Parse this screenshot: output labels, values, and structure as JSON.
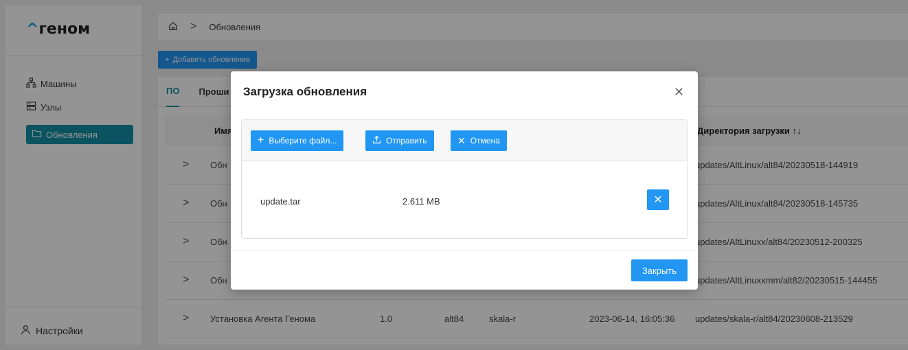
{
  "logo": {
    "caret": "^",
    "text": "геном"
  },
  "sidebar": {
    "items": [
      {
        "label": "Машины",
        "icon": "sitemap-icon"
      },
      {
        "label": "Узлы",
        "icon": "server-icon"
      },
      {
        "label": "Обновления",
        "icon": "folder-icon",
        "active": true
      }
    ],
    "settings_label": "Настройки"
  },
  "breadcrumb": {
    "home_icon": "home-icon",
    "separator": ">",
    "current": "Обновления"
  },
  "toolbar": {
    "add_label": "Добавить обновление"
  },
  "tabs": [
    {
      "label": "ПО",
      "active": true
    },
    {
      "label": "Проши"
    }
  ],
  "table": {
    "headers": {
      "name": "Имя",
      "dir": "Директория загрузки ↑↓"
    },
    "rows": [
      {
        "name": "Обн",
        "version": "",
        "arch": "",
        "os": "",
        "date": "",
        "dir": "updates/AltLinux/alt84/20230518-144919"
      },
      {
        "name": "Обн",
        "version": "",
        "arch": "",
        "os": "",
        "date": "",
        "dir": "updates/AltLinux/alt84/20230518-145735"
      },
      {
        "name": "Обн",
        "version": "",
        "arch": "",
        "os": "",
        "date": "",
        "dir": "updates/AltLinuxx/alt84/20230512-200325"
      },
      {
        "name": "Обн",
        "version": "",
        "arch": "",
        "os": "",
        "date": "",
        "dir": "updates/AltLinuxxmm/alt82/20230515-144455"
      },
      {
        "name": "Установка Агента Генома",
        "version": "1.0",
        "arch": "alt84",
        "os": "skala-r",
        "date": "2023-06-14, 16:05:36",
        "dir": "updates/skala-r/alt84/20230608-213529"
      }
    ]
  },
  "dialog": {
    "title": "Загрузка обновления",
    "choose_label": "Выберите файл...",
    "upload_label": "Отправить",
    "cancel_label": "Отмена",
    "file": {
      "name": "update.tar",
      "size": "2.611 MB"
    },
    "close_label": "Закрыть"
  },
  "colors": {
    "accent": "#2196f3",
    "active_nav": "#1390a7",
    "brand_caret": "#1fa0c8"
  }
}
